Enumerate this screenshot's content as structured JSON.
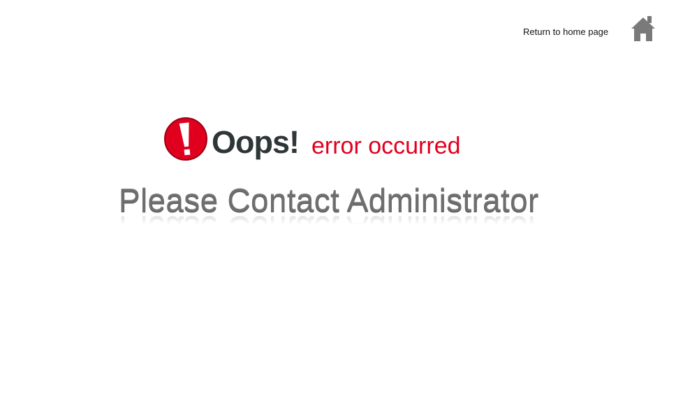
{
  "header": {
    "home_link": "Return to home page",
    "home_icon": "home-icon"
  },
  "error": {
    "title": "Oops!",
    "subtitle": "error occurred",
    "message": "Please Contact Administrator",
    "icon": "exclamation-icon",
    "accent": "#e0001e"
  }
}
